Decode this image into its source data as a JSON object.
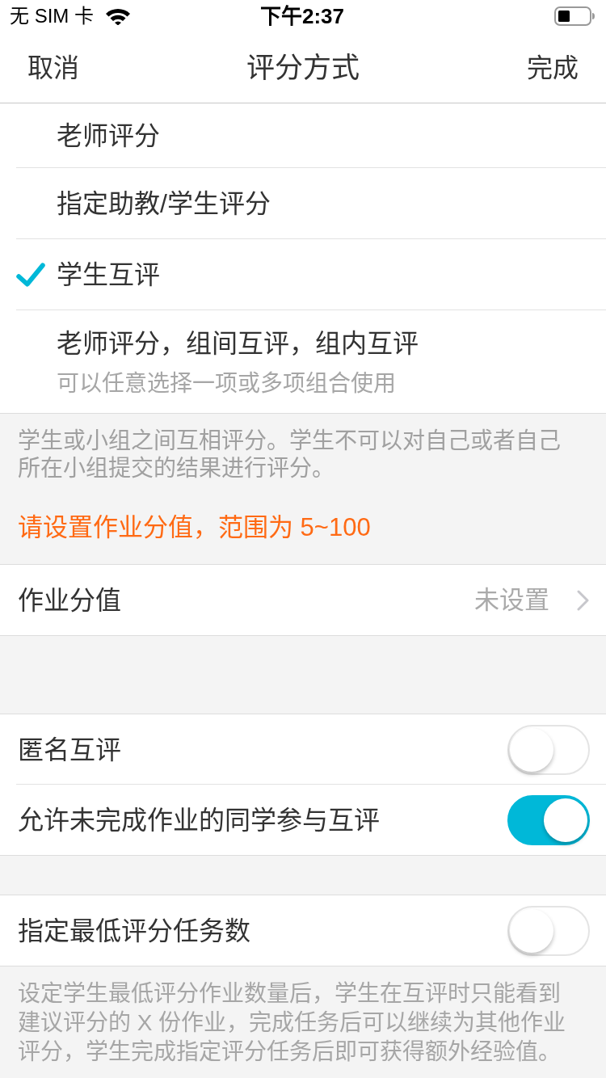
{
  "status_bar": {
    "carrier": "无 SIM 卡",
    "time": "下午2:37"
  },
  "nav": {
    "cancel": "取消",
    "title": "评分方式",
    "done": "完成"
  },
  "options": [
    {
      "label": "老师评分",
      "selected": false
    },
    {
      "label": "指定助教/学生评分",
      "selected": false
    },
    {
      "label": "学生互评",
      "selected": true
    },
    {
      "label": "老师评分，组间互评，组内互评",
      "subtitle": "可以任意选择一项或多项组合使用",
      "selected": false
    }
  ],
  "description": "学生或小组之间互相评分。学生不可以对自己或者自己所在小组提交的结果进行评分。",
  "warning": "请设置作业分值，范围为 5~100",
  "score_row": {
    "label": "作业分值",
    "value": "未设置"
  },
  "switch_groups": [
    {
      "switches": [
        {
          "label": "匿名互评",
          "on": false
        },
        {
          "label": "允许未完成作业的同学参与互评",
          "on": true
        }
      ]
    },
    {
      "switches": [
        {
          "label": "指定最低评分任务数",
          "on": false
        }
      ]
    }
  ],
  "footer_note": "设定学生最低评分作业数量后，学生在互评时只能看到建议评分的 X 份作业，完成任务后可以继续为其他作业评分，学生完成指定评分任务后即可获得额外经验值。"
}
